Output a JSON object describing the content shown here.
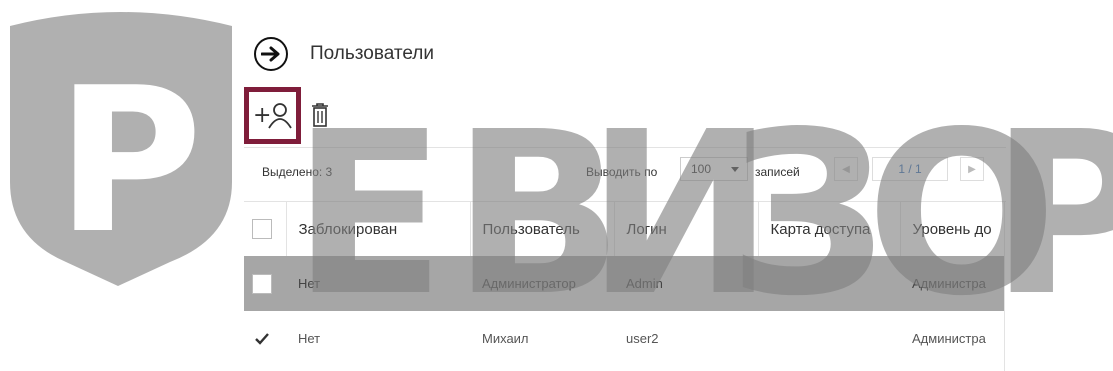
{
  "watermark": {
    "letters": [
      "Р",
      "Е",
      "В",
      "И",
      "З",
      "О",
      "Р"
    ],
    "color": "#808080"
  },
  "header": {
    "back_icon": "arrow-right-circle-icon",
    "title": "Пользователи"
  },
  "toolbar": {
    "add_user_icon": "add-user-icon",
    "add_user_glyph": "+",
    "delete_icon": "trash-icon",
    "highlight_color": "#7f1d3a"
  },
  "status": {
    "selected_text": "Выделено: 3",
    "per_page_label": "Выводить по",
    "per_page_value": "100",
    "records_label": "записей",
    "page_text": "1 / 1",
    "prev_icon": "chevron-left-icon",
    "next_icon": "chevron-right-icon",
    "page_color": "#2a6ab8"
  },
  "table": {
    "columns": [
      "Заблокирован",
      "Пользователь",
      "Логин",
      "Карта доступа",
      "Уровень до"
    ],
    "rows": [
      {
        "checked": false,
        "highlighted": true,
        "cells": [
          "Нет",
          "Администратор",
          "Admin",
          "",
          "Администра"
        ]
      },
      {
        "checked": true,
        "highlighted": false,
        "cells": [
          "Нет",
          "Михаил",
          "user2",
          "",
          "Администра"
        ]
      }
    ],
    "highlight_color": "#a6a6a6"
  }
}
